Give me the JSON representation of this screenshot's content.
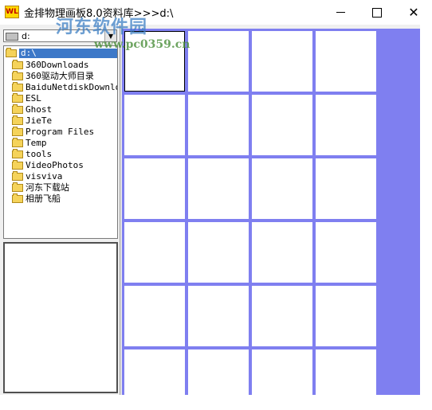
{
  "window": {
    "title": "金排物理画板8.0资料库>>>d:\\",
    "app_icon_text": "WL",
    "minimize_label": "—",
    "close_label": "✕"
  },
  "watermark": {
    "text": "河东软件园",
    "url": "www.pc0359.cn"
  },
  "drive_selector": {
    "value": "d:"
  },
  "folder_tree": {
    "root_label": "d:\\",
    "items": [
      "360Downloads",
      "360驱动大师目录",
      "BaiduNetdiskDownloa",
      "ESL",
      "Ghost",
      "JieTe",
      "Program Files",
      "Temp",
      "tools",
      "VideoPhotos",
      "visviva",
      "河东下载站",
      "相册飞船"
    ]
  },
  "thumbnail_grid": {
    "columns": 4,
    "rows": 6,
    "selected_index": 0
  },
  "colors": {
    "grid_background": "#7f7ff0",
    "selection": "#3c78c8",
    "folder": "#f5d35a"
  }
}
